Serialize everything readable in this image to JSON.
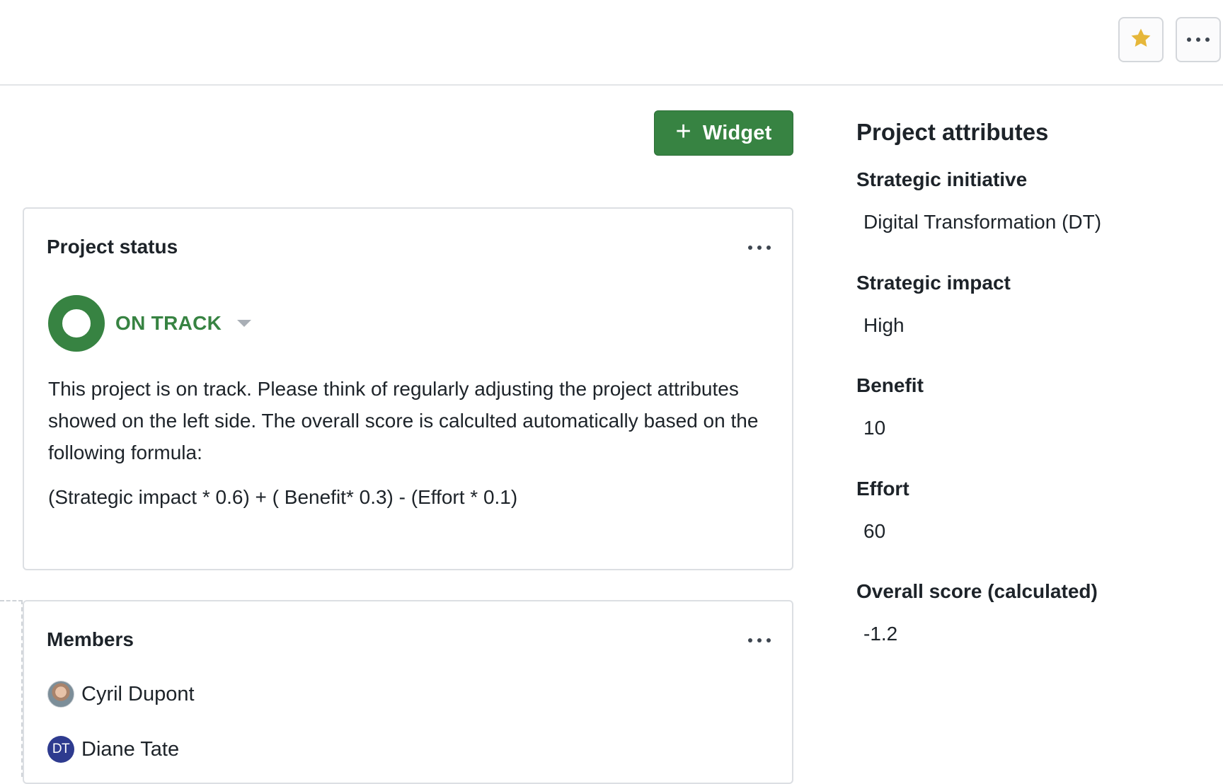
{
  "header": {
    "favorite_icon": "star-icon",
    "favorite_color": "#e6b73a",
    "more_icon": "more-horizontal-icon"
  },
  "toolbar": {
    "add_widget_label": "Widget",
    "add_widget_icon": "plus-icon",
    "accent": "#378342"
  },
  "status_widget": {
    "title": "Project status",
    "status": "ON TRACK",
    "status_color": "#378342",
    "description": "This project is on track. Please think of regularly adjusting the project attributes showed on the left side. The overall score is calculted automatically based on the following formula:",
    "formula": "(Strategic impact * 0.6) + ( Benefit* 0.3) - (Effort * 0.1)"
  },
  "members_widget": {
    "title": "Members",
    "members": [
      {
        "name": "Cyril Dupont",
        "avatar": "photo"
      },
      {
        "name": "Diane Tate",
        "avatar_initials": "DT",
        "avatar_color": "#2e3b8f"
      }
    ]
  },
  "attributes": {
    "title": "Project attributes",
    "items": [
      {
        "label": "Strategic initiative",
        "value": "Digital Transformation (DT)"
      },
      {
        "label": "Strategic impact",
        "value": "High"
      },
      {
        "label": "Benefit",
        "value": "10"
      },
      {
        "label": "Effort",
        "value": "60"
      },
      {
        "label": "Overall score (calculated)",
        "value": "-1.2"
      }
    ]
  }
}
